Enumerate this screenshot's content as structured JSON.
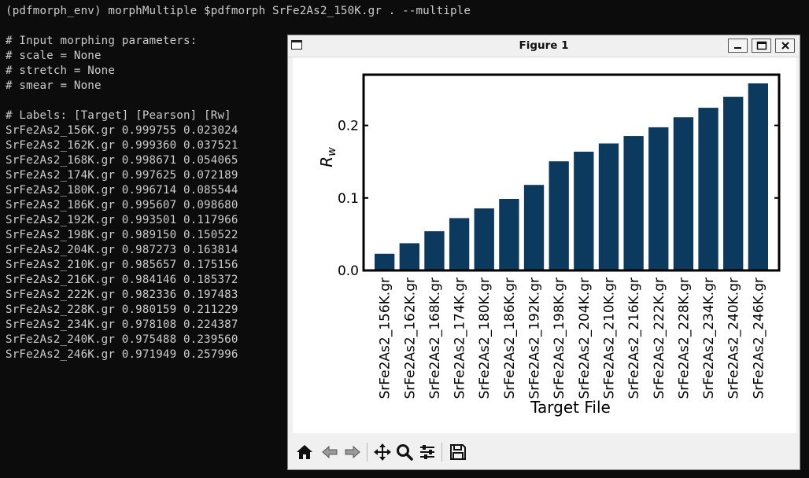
{
  "terminal": {
    "command_line": "(pdfmorph_env) morphMultiple $pdfmorph SrFe2As2_150K.gr . --multiple",
    "params_header": "# Input morphing parameters:",
    "params": [
      "# scale = None",
      "# stretch = None",
      "# smear = None"
    ],
    "labels_line": "# Labels: [Target] [Pearson] [Rw]",
    "results": [
      "SrFe2As2_156K.gr 0.999755 0.023024",
      "SrFe2As2_162K.gr 0.999360 0.037521",
      "SrFe2As2_168K.gr 0.998671 0.054065",
      "SrFe2As2_174K.gr 0.997625 0.072189",
      "SrFe2As2_180K.gr 0.996714 0.085544",
      "SrFe2As2_186K.gr 0.995607 0.098680",
      "SrFe2As2_192K.gr 0.993501 0.117966",
      "SrFe2As2_198K.gr 0.989150 0.150522",
      "SrFe2As2_204K.gr 0.987273 0.163814",
      "SrFe2As2_210K.gr 0.985657 0.175156",
      "SrFe2As2_216K.gr 0.984146 0.185372",
      "SrFe2As2_222K.gr 0.982336 0.197483",
      "SrFe2As2_228K.gr 0.980159 0.211229",
      "SrFe2As2_234K.gr 0.978108 0.224387",
      "SrFe2As2_240K.gr 0.975488 0.239560",
      "SrFe2As2_246K.gr 0.971949 0.257996"
    ]
  },
  "window": {
    "title": "Figure 1",
    "controls": [
      "minimize-icon",
      "maximize-icon",
      "close-icon"
    ]
  },
  "toolbar": {
    "buttons": [
      "home-icon",
      "back-arrow-icon",
      "forward-arrow-icon",
      "pan-icon",
      "zoom-icon",
      "configure-subplots-icon",
      "save-icon"
    ]
  },
  "chart_data": {
    "type": "bar",
    "categories": [
      "SrFe2As2_156K.gr",
      "SrFe2As2_162K.gr",
      "SrFe2As2_168K.gr",
      "SrFe2As2_174K.gr",
      "SrFe2As2_180K.gr",
      "SrFe2As2_186K.gr",
      "SrFe2As2_192K.gr",
      "SrFe2As2_198K.gr",
      "SrFe2As2_204K.gr",
      "SrFe2As2_210K.gr",
      "SrFe2As2_216K.gr",
      "SrFe2As2_222K.gr",
      "SrFe2As2_228K.gr",
      "SrFe2As2_234K.gr",
      "SrFe2As2_240K.gr",
      "SrFe2As2_246K.gr"
    ],
    "values": [
      0.023024,
      0.037521,
      0.054065,
      0.072189,
      0.085544,
      0.09868,
      0.117966,
      0.150522,
      0.163814,
      0.175156,
      0.185372,
      0.197483,
      0.211229,
      0.224387,
      0.23956,
      0.257996
    ],
    "title": "",
    "xlabel": "Target File",
    "ylabel_main": "R",
    "ylabel_sub": "w",
    "ylim": [
      0,
      0.27
    ],
    "yticks": [
      0.0,
      0.1,
      0.2
    ],
    "ytick_labels": [
      "0.0",
      "0.1",
      "0.2"
    ],
    "bar_color": "#0b3a5e",
    "grid": false
  }
}
